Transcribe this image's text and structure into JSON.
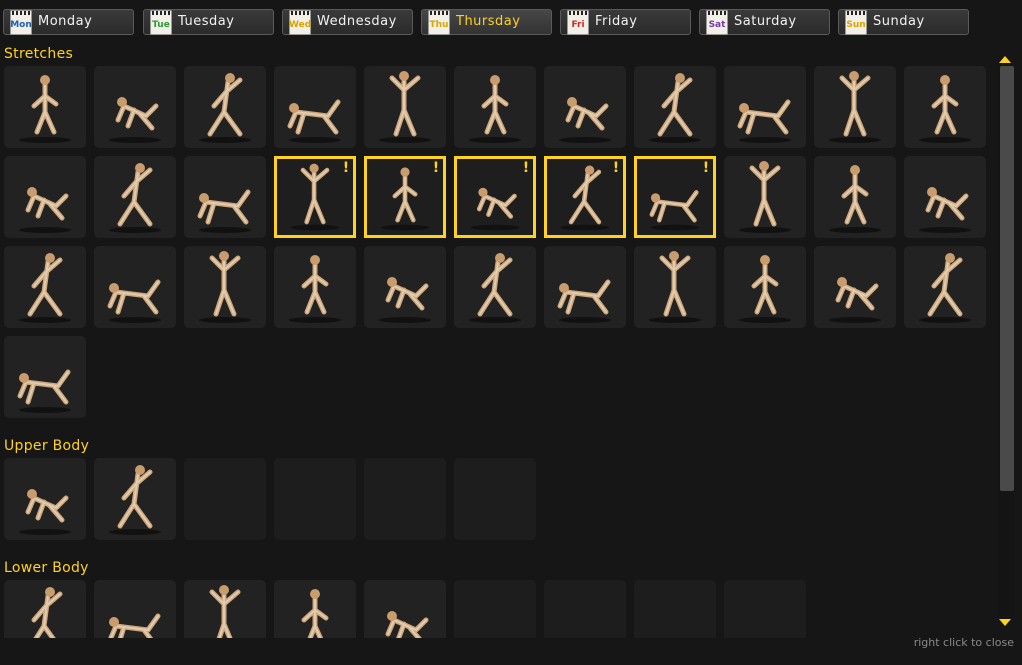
{
  "tabs": [
    {
      "label": "Monday",
      "icon_text": "Mon",
      "icon_color": "#1f5fb0",
      "active": false
    },
    {
      "label": "Tuesday",
      "icon_text": "Tue",
      "icon_color": "#2a9a3a",
      "active": false
    },
    {
      "label": "Wednesday",
      "icon_text": "Wed",
      "icon_color": "#d9a300",
      "active": false
    },
    {
      "label": "Thursday",
      "icon_text": "Thu",
      "icon_color": "#d9a300",
      "active": true
    },
    {
      "label": "Friday",
      "icon_text": "Fri",
      "icon_color": "#cc2a2a",
      "active": false
    },
    {
      "label": "Saturday",
      "icon_text": "Sat",
      "icon_color": "#7a3aa8",
      "active": false
    },
    {
      "label": "Sunday",
      "icon_text": "Sun",
      "icon_color": "#d9a300",
      "active": false
    }
  ],
  "sections": [
    {
      "title": "Stretches",
      "tiles": [
        {
          "state": "exercise"
        },
        {
          "state": "exercise"
        },
        {
          "state": "exercise"
        },
        {
          "state": "exercise"
        },
        {
          "state": "exercise"
        },
        {
          "state": "exercise"
        },
        {
          "state": "exercise"
        },
        {
          "state": "exercise"
        },
        {
          "state": "exercise"
        },
        {
          "state": "exercise"
        },
        {
          "state": "exercise"
        },
        {
          "state": "exercise"
        },
        {
          "state": "exercise"
        },
        {
          "state": "exercise"
        },
        {
          "state": "selected",
          "badge": "!"
        },
        {
          "state": "selected",
          "badge": "!"
        },
        {
          "state": "selected",
          "badge": "!"
        },
        {
          "state": "selected",
          "badge": "!"
        },
        {
          "state": "selected",
          "badge": "!"
        },
        {
          "state": "exercise"
        },
        {
          "state": "exercise"
        },
        {
          "state": "exercise"
        },
        {
          "state": "exercise"
        },
        {
          "state": "exercise"
        },
        {
          "state": "exercise"
        },
        {
          "state": "exercise"
        },
        {
          "state": "exercise"
        },
        {
          "state": "exercise"
        },
        {
          "state": "exercise"
        },
        {
          "state": "exercise"
        },
        {
          "state": "exercise"
        },
        {
          "state": "exercise"
        },
        {
          "state": "exercise"
        },
        {
          "state": "exercise"
        }
      ]
    },
    {
      "title": "Upper Body",
      "tiles": [
        {
          "state": "exercise"
        },
        {
          "state": "exercise"
        },
        {
          "state": "empty"
        },
        {
          "state": "empty"
        },
        {
          "state": "empty"
        },
        {
          "state": "empty"
        }
      ]
    },
    {
      "title": "Lower Body",
      "tiles": [
        {
          "state": "exercise"
        },
        {
          "state": "exercise"
        },
        {
          "state": "exercise"
        },
        {
          "state": "exercise"
        },
        {
          "state": "exercise"
        },
        {
          "state": "empty"
        },
        {
          "state": "empty"
        },
        {
          "state": "empty"
        },
        {
          "state": "empty"
        }
      ]
    }
  ],
  "hint": "right click to close",
  "colors": {
    "accent": "#ffd21f",
    "background": "#161616",
    "tile": "#222222"
  }
}
